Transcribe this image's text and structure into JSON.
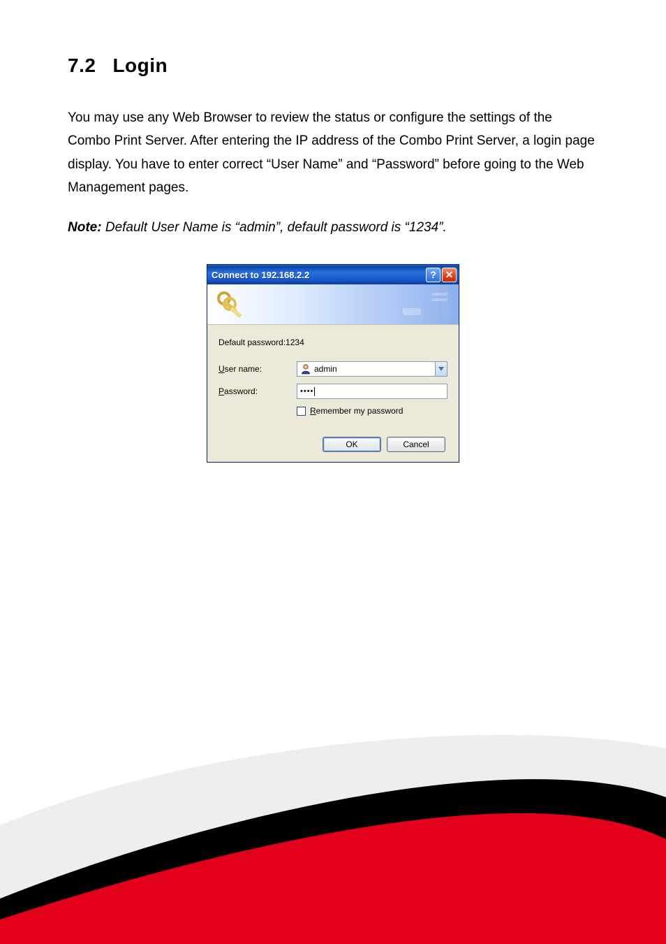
{
  "section": {
    "number": "7.2",
    "title": "Login"
  },
  "paragraph": "You may use any Web Browser to review the status or configure the settings of the Combo Print Server. After entering the IP address of the Combo Print Server, a login page display. You have to enter correct “User Name” and “Password” before going to the Web Management pages.",
  "note": {
    "label": "Note:",
    "body": " Default User Name is “admin”, default password is “1234”."
  },
  "dialog": {
    "title": "Connect to 192.168.2.2",
    "help_symbol": "?",
    "close_symbol": "✕",
    "realm": "Default password:1234",
    "username_label_pre": "U",
    "username_label_post": "ser name:",
    "username_value": "admin",
    "password_label_pre": "P",
    "password_label_post": "assword:",
    "password_value": "••••",
    "remember_label_pre": "R",
    "remember_label_post": "emember my password",
    "ok_label": "OK",
    "cancel_label": "Cancel"
  }
}
